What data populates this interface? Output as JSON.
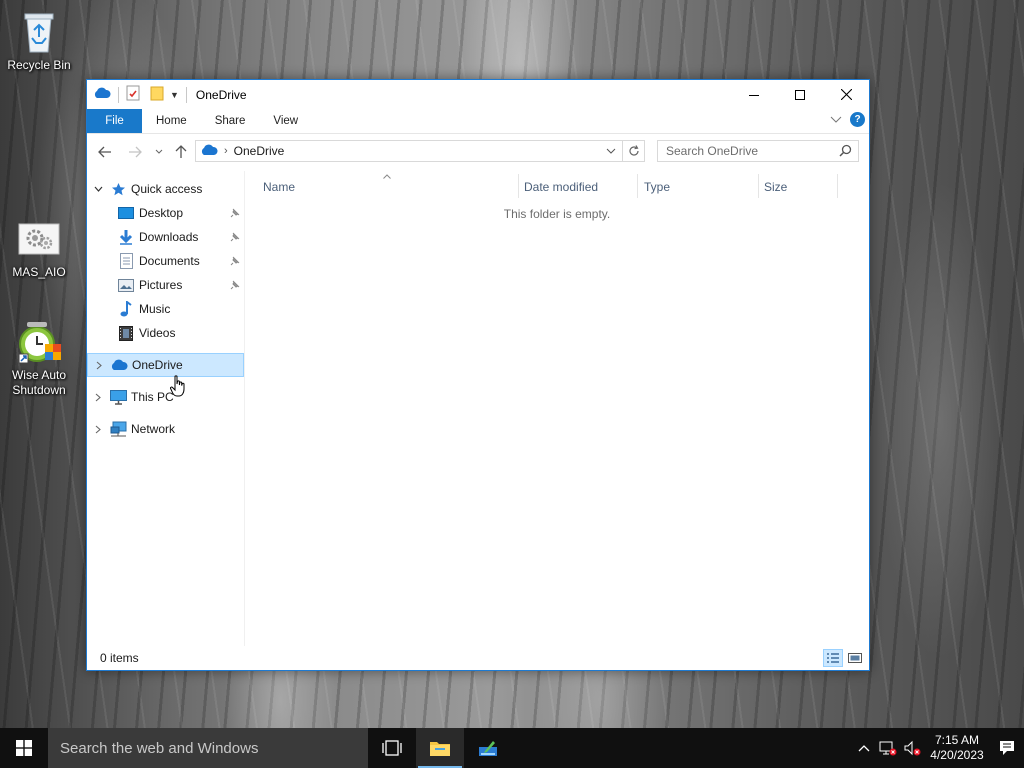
{
  "desktop": {
    "icons": [
      {
        "label": "Recycle Bin"
      },
      {
        "label": "MAS_AIO"
      },
      {
        "label": "Wise Auto Shutdown"
      }
    ]
  },
  "window": {
    "title": "OneDrive",
    "accent": "#1979ca",
    "ribbon_tabs": [
      "File",
      "Home",
      "Share",
      "View"
    ],
    "help": "?",
    "address": {
      "crumb": "OneDrive"
    },
    "search": {
      "placeholder": "Search OneDrive"
    },
    "nav": {
      "quick_access": "Quick access",
      "quick_items": [
        "Desktop",
        "Downloads",
        "Documents",
        "Pictures",
        "Music",
        "Videos"
      ],
      "onedrive": "OneDrive",
      "this_pc": "This PC",
      "network": "Network"
    },
    "columns": [
      "Name",
      "Date modified",
      "Type",
      "Size"
    ],
    "empty_message": "This folder is empty.",
    "status": "0 items"
  },
  "taskbar": {
    "search_placeholder": "Search the web and Windows",
    "time": "7:15 AM",
    "date": "4/20/2023"
  }
}
